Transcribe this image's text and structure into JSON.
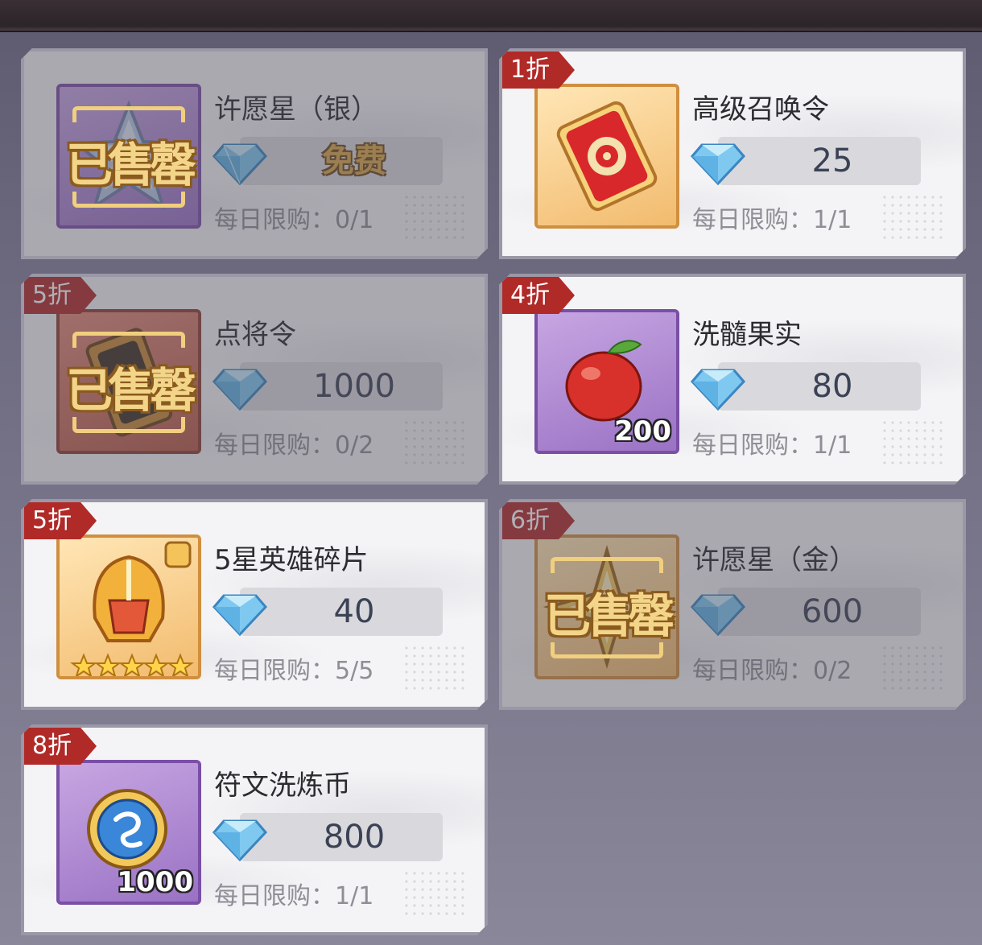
{
  "currency_icon": "diamond-icon",
  "sold_stamp_text": "已售罄",
  "limit_label": "每日限购：",
  "items": [
    {
      "name": "许愿星（银）",
      "price": "免费",
      "limit": "每日限购：0/1",
      "discount": "",
      "icon": "silver-star-icon",
      "sold_out": true
    },
    {
      "name": "高级召唤令",
      "price": "25",
      "limit": "每日限购：1/1",
      "discount": "1折",
      "icon": "summon-token-icon",
      "sold_out": false
    },
    {
      "name": "点将令",
      "price": "1000",
      "limit": "每日限购：0/2",
      "discount": "5折",
      "icon": "general-token-icon",
      "sold_out": true
    },
    {
      "name": "洗髓果实",
      "price": "80",
      "limit": "每日限购：1/1",
      "discount": "4折",
      "icon": "red-fruit-icon",
      "quantity": "200",
      "sold_out": false
    },
    {
      "name": "5星英雄碎片",
      "price": "40",
      "limit": "每日限购：5/5",
      "discount": "5折",
      "icon": "hero-helmet-fragment-icon",
      "sold_out": false
    },
    {
      "name": "许愿星（金）",
      "price": "600",
      "limit": "每日限购：0/2",
      "discount": "6折",
      "icon": "gold-star-icon",
      "sold_out": true
    },
    {
      "name": "符文洗炼币",
      "price": "800",
      "limit": "每日限购：1/1",
      "discount": "8折",
      "icon": "rune-coin-icon",
      "quantity": "1000",
      "sold_out": false
    }
  ]
}
